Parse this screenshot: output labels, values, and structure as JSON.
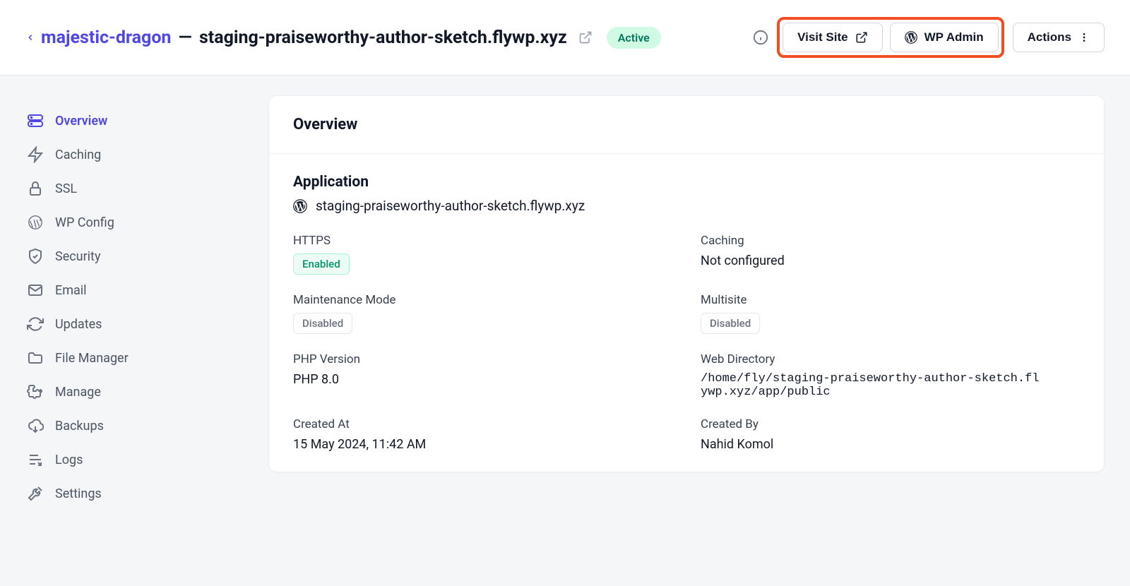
{
  "header": {
    "server_name": "majestic-dragon",
    "separator": "—",
    "domain": "staging-praiseworthy-author-sketch.flywp.xyz",
    "status": "Active",
    "visit_site_label": "Visit Site",
    "wp_admin_label": "WP Admin",
    "actions_label": "Actions"
  },
  "sidebar": {
    "items": [
      {
        "label": "Overview"
      },
      {
        "label": "Caching"
      },
      {
        "label": "SSL"
      },
      {
        "label": "WP Config"
      },
      {
        "label": "Security"
      },
      {
        "label": "Email"
      },
      {
        "label": "Updates"
      },
      {
        "label": "File Manager"
      },
      {
        "label": "Manage"
      },
      {
        "label": "Backups"
      },
      {
        "label": "Logs"
      },
      {
        "label": "Settings"
      }
    ]
  },
  "main": {
    "card_title": "Overview",
    "application_title": "Application",
    "application_domain": "staging-praiseworthy-author-sketch.flywp.xyz",
    "fields": {
      "https_label": "HTTPS",
      "https_value": "Enabled",
      "caching_label": "Caching",
      "caching_value": "Not configured",
      "maint_label": "Maintenance Mode",
      "maint_value": "Disabled",
      "multisite_label": "Multisite",
      "multisite_value": "Disabled",
      "php_label": "PHP Version",
      "php_value": "PHP 8.0",
      "webdir_label": "Web Directory",
      "webdir_value": "/home/fly/staging-praiseworthy-author-sketch.flywp.xyz/app/public",
      "created_at_label": "Created At",
      "created_at_value": "15 May 2024, 11:42 AM",
      "created_by_label": "Created By",
      "created_by_value": "Nahid Komol"
    }
  }
}
